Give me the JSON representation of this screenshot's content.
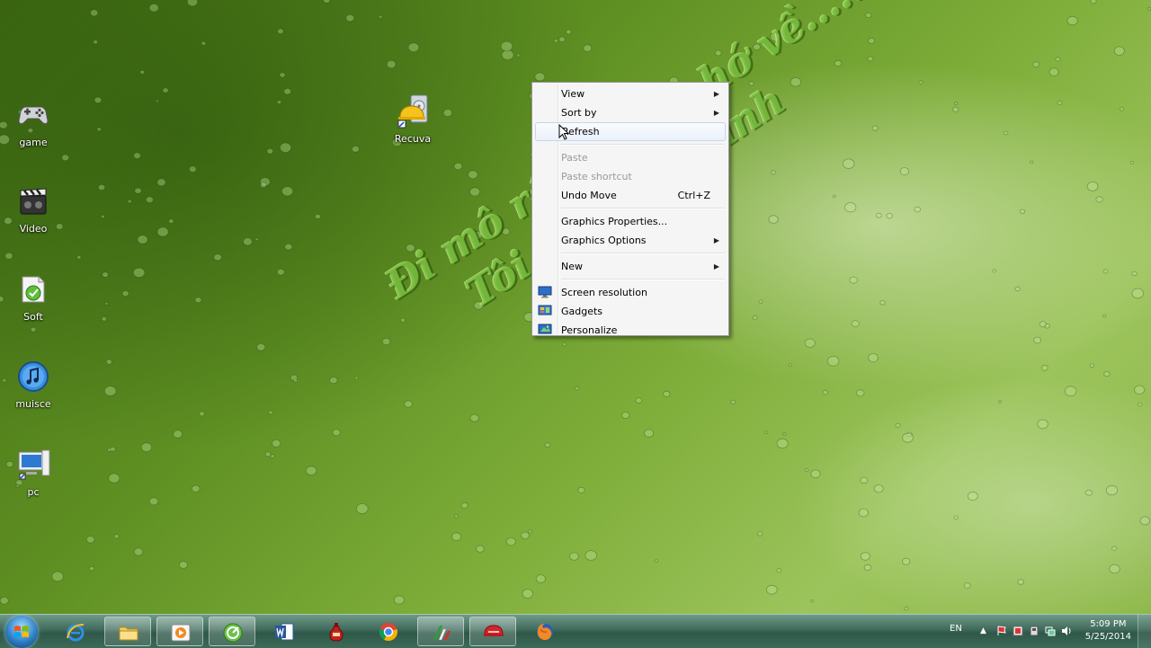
{
  "desktop_icons": [
    {
      "label": "game",
      "icon": "gamepad-icon"
    },
    {
      "label": "Video",
      "icon": "film-clapper-icon"
    },
    {
      "label": "Soft",
      "icon": "soft-folder-icon"
    },
    {
      "label": "muisce",
      "icon": "music-note-icon"
    },
    {
      "label": "pc",
      "icon": "computer-icon"
    },
    {
      "label": "Recuva",
      "icon": "recuva-icon"
    }
  ],
  "wallpaper": {
    "line1": "Đi mô rồi cũng nhớ về.....",
    "line2": "Tôi.........Hà Tĩnh"
  },
  "context_menu": {
    "view": "View",
    "sort_by": "Sort by",
    "refresh": "Refresh",
    "paste": "Paste",
    "paste_shortcut": "Paste shortcut",
    "undo_move": "Undo Move",
    "undo_shortcut": "Ctrl+Z",
    "graphics_properties": "Graphics Properties...",
    "graphics_options": "Graphics Options",
    "new": "New",
    "screen_resolution": "Screen resolution",
    "gadgets": "Gadgets",
    "personalize": "Personalize"
  },
  "taskbar": {
    "pinned": [
      "internet-explorer-icon",
      "file-explorer-icon",
      "media-player-icon",
      "app-green-icon",
      "word-icon",
      "bottle-app-icon",
      "chrome-icon",
      "app-tricolor-icon",
      "media-app-icon",
      "firefox-icon"
    ],
    "lang": "EN",
    "time": "5:09 PM",
    "date": "5/25/2014"
  },
  "colors": {
    "menu_bg": "#f5f5f5",
    "taskbar": "#3f6a5c",
    "accent": "#2f7fc6"
  }
}
